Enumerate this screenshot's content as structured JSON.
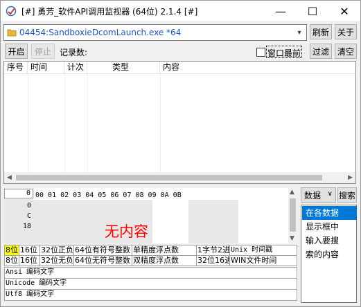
{
  "window": {
    "title": "[#] 勇芳_软件API调用监视器 (64位) 2.1.4 [#]",
    "minimize_glyph": "—",
    "maximize_glyph": "☐",
    "close_glyph": "✕"
  },
  "process": {
    "selected": "04454:SandboxieDcomLaunch.exe *64",
    "icon": "folder-icon"
  },
  "toolbar": {
    "refresh": "刷新",
    "about": "关于",
    "start": "开启",
    "stop": "停止",
    "record_count_label": "记录数:",
    "topmost_label": "窗口最前",
    "filter": "过滤",
    "clear": "清空"
  },
  "table": {
    "columns": [
      "序号",
      "时间",
      "计次",
      "类型",
      "内容"
    ]
  },
  "hex": {
    "offset_input": "0",
    "header": "00 01 02 03 04 05 06 07 08 09 0A 0B",
    "offsets": [
      "0",
      "C",
      "18"
    ],
    "empty_message": "无内容"
  },
  "data_panel": {
    "mode_select": "数据",
    "search": "搜索",
    "items": [
      "在各数据",
      "显示框中",
      "输入要搜",
      "索的内容"
    ],
    "selected_index": 0
  },
  "type_grid": {
    "row1": [
      "8位",
      "16位",
      "32位正负",
      "64位有符号整数",
      "单精度浮点数",
      "",
      "1字节2进",
      "Unix 时间戳"
    ],
    "row2": [
      "8位",
      "16位",
      "32位无负",
      "64位无符号整数",
      "双精度浮点数",
      "",
      "32位16进",
      "WIN文件时间"
    ],
    "ansi": "Ansi 编码文字",
    "unicode": "Unicode 编码文字",
    "utf8": "Utf8 编码文字"
  },
  "colors": {
    "accent": "#0078d7",
    "process_text": "#1a56c8",
    "empty_text": "#ff0000",
    "highlight": "#ffff00"
  }
}
